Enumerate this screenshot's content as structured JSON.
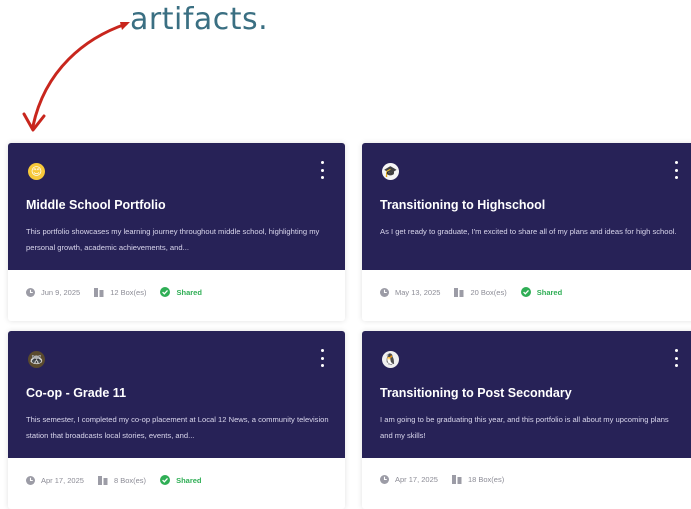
{
  "annotation": {
    "text": "artifacts."
  },
  "cards": [
    {
      "title": "Middle School Portfolio",
      "description": "This portfolio showcases my learning journey throughout middle school, highlighting my personal growth, academic achievements, and...",
      "date": "Jun 9, 2025",
      "boxes": "12 Box(es)",
      "status": "Shared",
      "avatar": "😊"
    },
    {
      "title": "Transitioning to Highschool",
      "description": "As I get ready to graduate, I'm excited to share all of my plans and ideas for high school.",
      "date": "May 13, 2025",
      "boxes": "20 Box(es)",
      "status": "Shared",
      "avatar": "🎓"
    },
    {
      "title": "Co-op - Grade 11",
      "description": "This semester, I completed my co-op placement at Local 12 News, a community television station that broadcasts local stories, events, and...",
      "date": "Apr 17, 2025",
      "boxes": "8 Box(es)",
      "status": "Shared",
      "avatar": "🦝"
    },
    {
      "title": "Transitioning to Post Secondary",
      "description": "I am going to be graduating this year, and this portfolio is all about my upcoming plans and my skills!",
      "date": "Apr 17, 2025",
      "boxes": "18 Box(es)",
      "status": "",
      "avatar": "🐧"
    }
  ],
  "colors": {
    "card_header": "#272257",
    "shared": "#2fae55",
    "arrow": "#c8261d",
    "annotation": "#3a6f82"
  }
}
